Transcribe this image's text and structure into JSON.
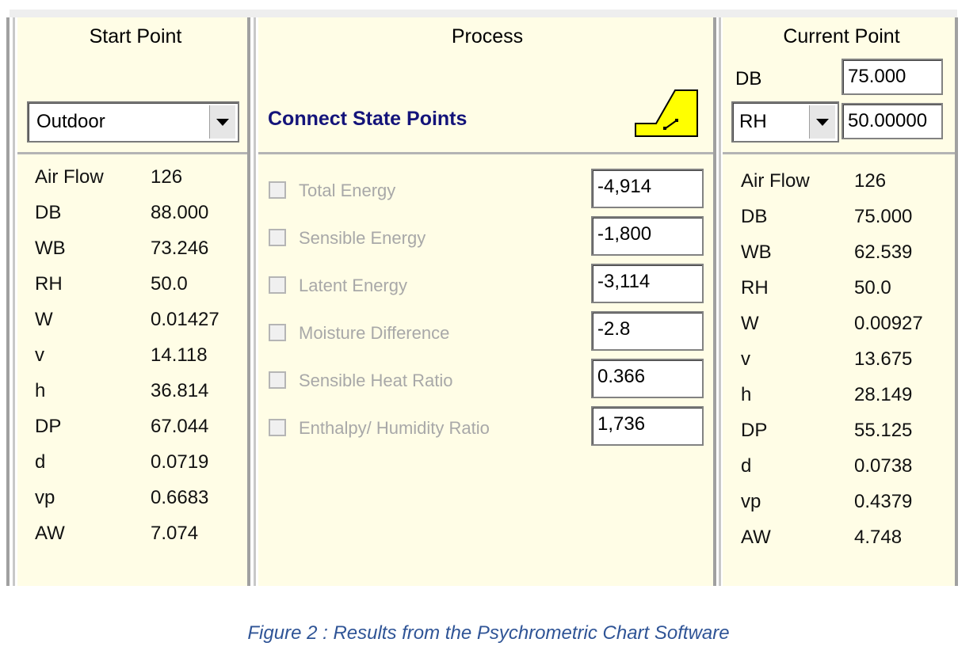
{
  "start_point": {
    "title": "Start Point",
    "selected": "Outdoor",
    "properties": [
      {
        "label": "Air Flow",
        "value": "126"
      },
      {
        "label": "DB",
        "value": "88.000"
      },
      {
        "label": "WB",
        "value": "73.246"
      },
      {
        "label": "RH",
        "value": "50.0"
      },
      {
        "label": "W",
        "value": "0.01427"
      },
      {
        "label": "v",
        "value": "14.118"
      },
      {
        "label": "h",
        "value": "36.814"
      },
      {
        "label": "DP",
        "value": "67.044"
      },
      {
        "label": "d",
        "value": "0.0719"
      },
      {
        "label": "vp",
        "value": "0.6683"
      },
      {
        "label": "AW",
        "value": "7.074"
      }
    ]
  },
  "process": {
    "title": "Process",
    "action": "Connect State Points",
    "icon": "connect-state-points-icon",
    "rows": [
      {
        "label": "Total Energy",
        "value": "-4,914"
      },
      {
        "label": "Sensible Energy",
        "value": "-1,800"
      },
      {
        "label": "Latent Energy",
        "value": "-3,114"
      },
      {
        "label": "Moisture Difference",
        "value": "-2.8"
      },
      {
        "label": "Sensible Heat Ratio",
        "value": "0.366"
      },
      {
        "label": "Enthalpy/ Humidity Ratio",
        "value": "1,736"
      }
    ]
  },
  "current_point": {
    "title": "Current Point",
    "db_label": "DB",
    "db_value": "75.000",
    "second_selected": "RH",
    "second_value": "50.00000",
    "properties": [
      {
        "label": "Air Flow",
        "value": "126"
      },
      {
        "label": "DB",
        "value": "75.000"
      },
      {
        "label": "WB",
        "value": "62.539"
      },
      {
        "label": "RH",
        "value": "50.0"
      },
      {
        "label": "W",
        "value": "0.00927"
      },
      {
        "label": "v",
        "value": "13.675"
      },
      {
        "label": "h",
        "value": "28.149"
      },
      {
        "label": "DP",
        "value": "55.125"
      },
      {
        "label": "d",
        "value": "0.0738"
      },
      {
        "label": "vp",
        "value": "0.4379"
      },
      {
        "label": "AW",
        "value": "4.748"
      }
    ]
  },
  "caption": "Figure 2 : Results from the Psychrometric Chart Software"
}
